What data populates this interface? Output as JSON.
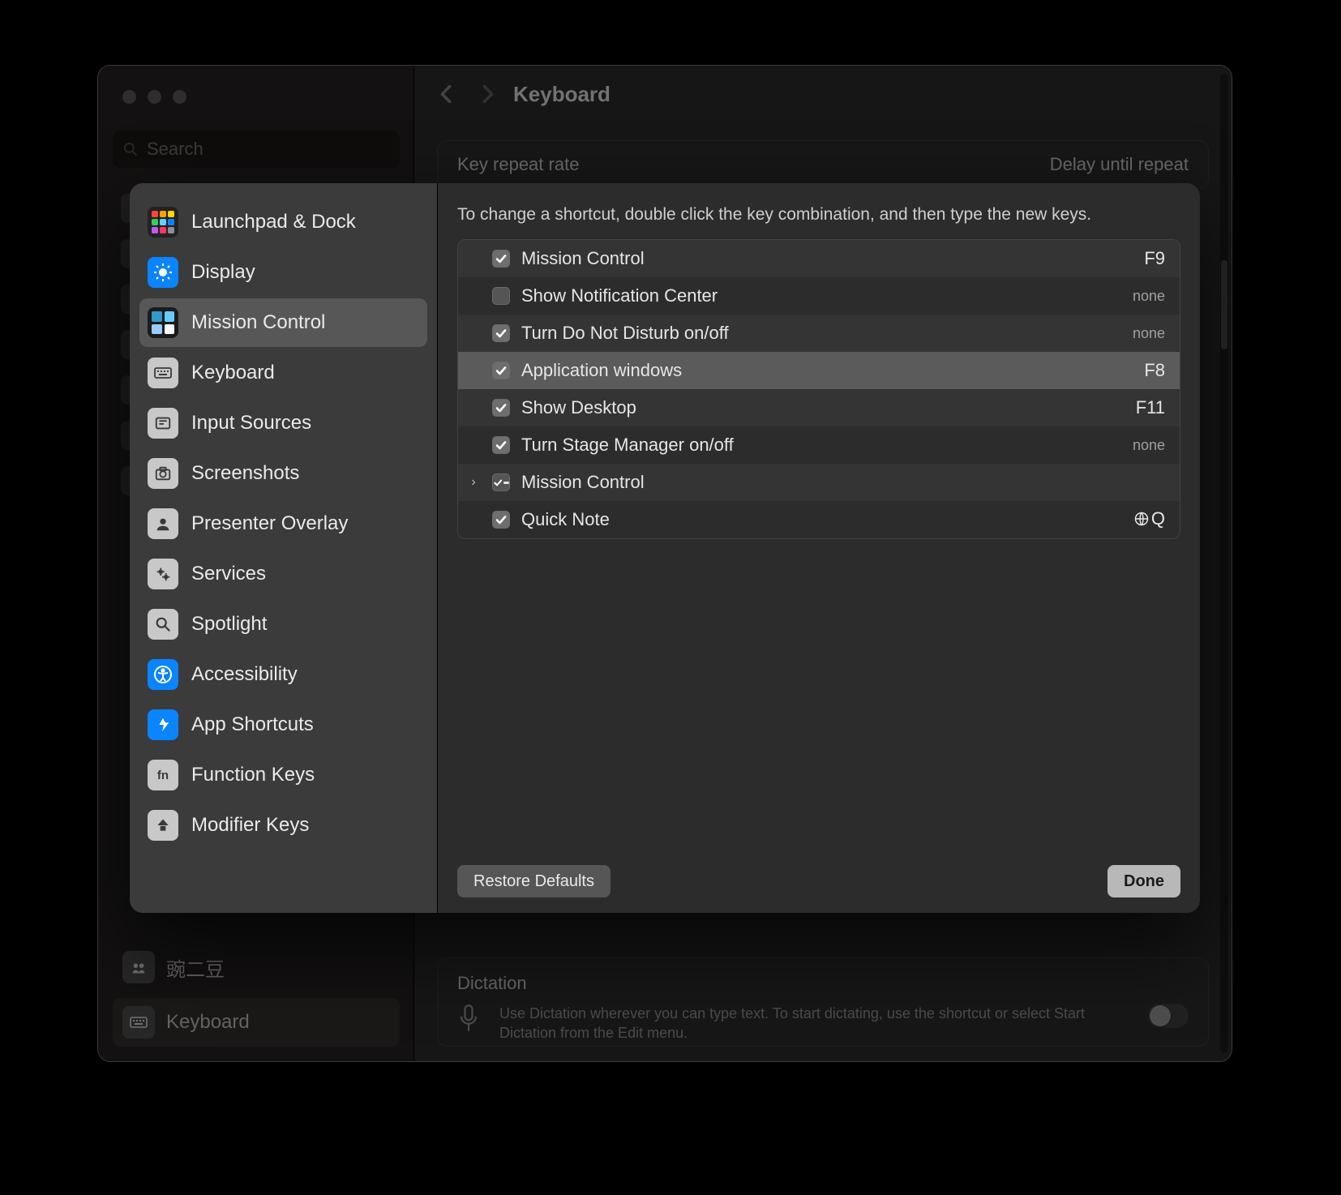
{
  "window": {
    "search_placeholder": "Search",
    "title": "Keyboard",
    "section_labels": {
      "key_repeat": "Key repeat rate",
      "delay_repeat": "Delay until repeat"
    },
    "dictation": {
      "title": "Dictation",
      "body": "Use Dictation wherever you can type text. To start dictating, use the shortcut or select Start Dictation from the Edit menu."
    },
    "sidebar_bottom": {
      "user": "豌二豆",
      "keyboard": "Keyboard"
    }
  },
  "sheet": {
    "hint": "To change a shortcut, double click the key combination, and then type the new keys.",
    "categories": [
      {
        "label": "Launchpad & Dock",
        "icon": "launchpad",
        "color": "grid"
      },
      {
        "label": "Display",
        "icon": "display",
        "color": "#0a84ff"
      },
      {
        "label": "Mission Control",
        "icon": "mission",
        "color": "mc",
        "selected": true
      },
      {
        "label": "Keyboard",
        "icon": "keyboard",
        "color": "#8e8e8e"
      },
      {
        "label": "Input Sources",
        "icon": "input",
        "color": "#8e8e8e"
      },
      {
        "label": "Screenshots",
        "icon": "camera",
        "color": "#8e8e8e"
      },
      {
        "label": "Presenter Overlay",
        "icon": "user",
        "color": "#8e8e8e"
      },
      {
        "label": "Services",
        "icon": "gears",
        "color": "#8e8e8e"
      },
      {
        "label": "Spotlight",
        "icon": "spotlight",
        "color": "#8e8e8e"
      },
      {
        "label": "Accessibility",
        "icon": "accessibility",
        "color": "#0a84ff"
      },
      {
        "label": "App Shortcuts",
        "icon": "appstore",
        "color": "#0a84ff"
      },
      {
        "label": "Function Keys",
        "icon": "fn",
        "color": "#8e8e8e"
      },
      {
        "label": "Modifier Keys",
        "icon": "modifier",
        "color": "#8e8e8e"
      }
    ],
    "shortcuts": [
      {
        "checked": true,
        "label": "Mission Control",
        "key": "F9"
      },
      {
        "checked": false,
        "label": "Show Notification Center",
        "key": "none",
        "none": true
      },
      {
        "checked": true,
        "label": "Turn Do Not Disturb on/off",
        "key": "none",
        "none": true
      },
      {
        "checked": true,
        "label": "Application windows",
        "key": "F8",
        "selected": true
      },
      {
        "checked": true,
        "label": "Show Desktop",
        "key": "F11"
      },
      {
        "checked": true,
        "label": "Turn Stage Manager on/off",
        "key": "none",
        "none": true
      },
      {
        "indeterminate": true,
        "expandable": true,
        "label": "Mission Control",
        "key": ""
      },
      {
        "checked": true,
        "label": "Quick Note",
        "key": "globeQ",
        "globe": true
      }
    ],
    "footer": {
      "restore": "Restore Defaults",
      "done": "Done"
    }
  }
}
